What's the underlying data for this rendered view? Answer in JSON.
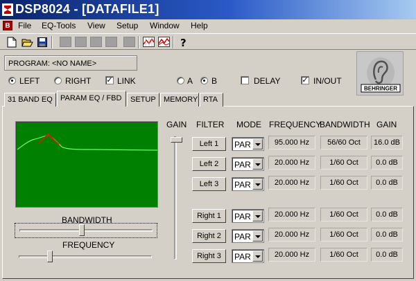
{
  "window": {
    "title": "DSP8024 - [DATAFILE1]"
  },
  "menu": {
    "items": [
      "File",
      "EQ-Tools",
      "View",
      "Setup",
      "Window",
      "Help"
    ]
  },
  "program": {
    "label": "PROGRAM: <NO NAME>"
  },
  "channel": {
    "left": {
      "label": "LEFT",
      "selected": true
    },
    "right": {
      "label": "RIGHT",
      "selected": false
    },
    "link": {
      "label": "LINK",
      "checked": true
    }
  },
  "bank": {
    "a": {
      "label": "A",
      "selected": false
    },
    "b": {
      "label": "B",
      "selected": true
    }
  },
  "delay": {
    "label": "DELAY",
    "checked": false
  },
  "inout": {
    "label": "IN/OUT",
    "checked": true
  },
  "logo": {
    "text": "BEHRINGER"
  },
  "tabs": [
    "31 BAND EQ",
    "PARAM EQ / FBD",
    "SETUP",
    "MEMORY",
    "RTA"
  ],
  "active_tab": 1,
  "headers": {
    "gain": "GAIN",
    "filter": "FILTER",
    "mode": "MODE",
    "frequency": "FREQUENCY",
    "bandwidth": "BANDWIDTH",
    "gain2": "GAIN"
  },
  "captions": {
    "bandwidth": "BANDWIDTH",
    "frequency": "FREQUENCY"
  },
  "filters": [
    {
      "label": "Left 1",
      "mode": "PAR",
      "frequency": "95.000 Hz",
      "bandwidth": "56/60 Oct",
      "gain": "16.0 dB"
    },
    {
      "label": "Left 2",
      "mode": "PAR",
      "frequency": "20.000 Hz",
      "bandwidth": "1/60 Oct",
      "gain": "0.0 dB"
    },
    {
      "label": "Left 3",
      "mode": "PAR",
      "frequency": "20.000 Hz",
      "bandwidth": "1/60 Oct",
      "gain": "0.0 dB"
    },
    {
      "label": "Right 1",
      "mode": "PAR",
      "frequency": "20.000 Hz",
      "bandwidth": "1/60 Oct",
      "gain": "0.0 dB"
    },
    {
      "label": "Right 2",
      "mode": "PAR",
      "frequency": "20.000 Hz",
      "bandwidth": "1/60 Oct",
      "gain": "0.0 dB"
    },
    {
      "label": "Right 3",
      "mode": "PAR",
      "frequency": "20.000 Hz",
      "bandwidth": "1/60 Oct",
      "gain": "0.0 dB"
    }
  ],
  "sliders": {
    "bandwidth_level": 0.48,
    "frequency_level": 0.24,
    "gain_level": 1.0
  },
  "colors": {
    "graph_bg": "#008000",
    "curve": "#66ff66",
    "marker": "#cc2200"
  },
  "icons": [
    "new-file-icon",
    "open-folder-icon",
    "save-disk-icon",
    "graph-icon",
    "graph-compare-icon",
    "help-icon"
  ]
}
